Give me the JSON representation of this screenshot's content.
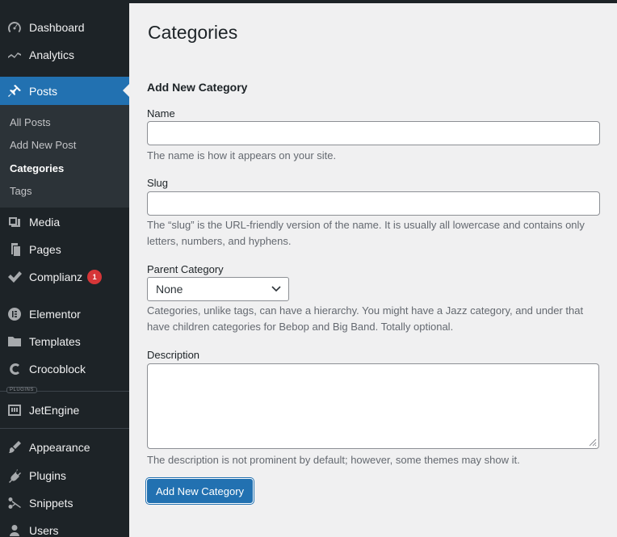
{
  "sidebar": {
    "items": [
      {
        "label": "Dashboard",
        "icon": "dashboard-icon"
      },
      {
        "label": "Analytics",
        "icon": "analytics-icon"
      },
      {
        "label": "Posts",
        "icon": "pin-icon"
      },
      {
        "label": "Media",
        "icon": "media-icon"
      },
      {
        "label": "Pages",
        "icon": "pages-icon"
      },
      {
        "label": "Complianz",
        "icon": "checkmark-icon",
        "badge": "1"
      },
      {
        "label": "Elementor",
        "icon": "elementor-icon"
      },
      {
        "label": "Templates",
        "icon": "folder-icon"
      },
      {
        "label": "Crocoblock",
        "icon": "crocoblock-icon"
      },
      {
        "label": "JetEngine",
        "icon": "jetengine-icon"
      },
      {
        "label": "Appearance",
        "icon": "brush-icon"
      },
      {
        "label": "Plugins",
        "icon": "plug-icon"
      },
      {
        "label": "Snippets",
        "icon": "scissors-icon"
      },
      {
        "label": "Users",
        "icon": "user-icon"
      }
    ],
    "submenu": [
      "All Posts",
      "Add New Post",
      "Categories",
      "Tags"
    ],
    "plugins_tag": "PLUGINS"
  },
  "main": {
    "title": "Categories",
    "form_title": "Add New Category",
    "name_label": "Name",
    "name_value": "",
    "name_hint": "The name is how it appears on your site.",
    "slug_label": "Slug",
    "slug_value": "",
    "slug_hint": "The “slug” is the URL-friendly version of the name. It is usually all lowercase and contains only letters, numbers, and hyphens.",
    "parent_label": "Parent Category",
    "parent_selected": "None",
    "parent_hint": "Categories, unlike tags, can have a hierarchy. You might have a Jazz category, and under that have children categories for Bebop and Big Band. Totally optional.",
    "description_label": "Description",
    "description_value": "",
    "description_hint": "The description is not prominent by default; however, some themes may show it.",
    "submit_label": "Add New Category"
  },
  "colors": {
    "sidebar_bg": "#1d2327",
    "active": "#2271b1",
    "submenu_bg": "#2c3338",
    "badge": "#d63638"
  }
}
